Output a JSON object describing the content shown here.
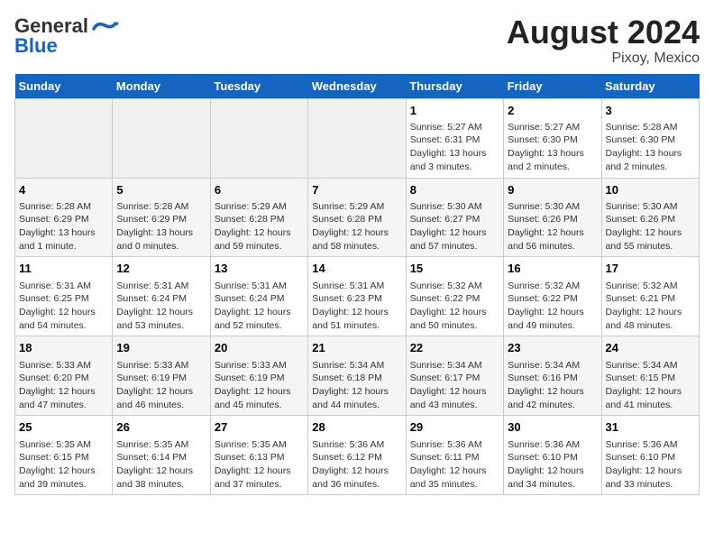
{
  "header": {
    "logo_general": "General",
    "logo_blue": "Blue",
    "title": "August 2024",
    "subtitle": "Pixoy, Mexico"
  },
  "days_of_week": [
    "Sunday",
    "Monday",
    "Tuesday",
    "Wednesday",
    "Thursday",
    "Friday",
    "Saturday"
  ],
  "weeks": [
    [
      {
        "day": "",
        "info": ""
      },
      {
        "day": "",
        "info": ""
      },
      {
        "day": "",
        "info": ""
      },
      {
        "day": "",
        "info": ""
      },
      {
        "day": "1",
        "info": "Sunrise: 5:27 AM\nSunset: 6:31 PM\nDaylight: 13 hours\nand 3 minutes."
      },
      {
        "day": "2",
        "info": "Sunrise: 5:27 AM\nSunset: 6:30 PM\nDaylight: 13 hours\nand 2 minutes."
      },
      {
        "day": "3",
        "info": "Sunrise: 5:28 AM\nSunset: 6:30 PM\nDaylight: 13 hours\nand 2 minutes."
      }
    ],
    [
      {
        "day": "4",
        "info": "Sunrise: 5:28 AM\nSunset: 6:29 PM\nDaylight: 13 hours\nand 1 minute."
      },
      {
        "day": "5",
        "info": "Sunrise: 5:28 AM\nSunset: 6:29 PM\nDaylight: 13 hours\nand 0 minutes."
      },
      {
        "day": "6",
        "info": "Sunrise: 5:29 AM\nSunset: 6:28 PM\nDaylight: 12 hours\nand 59 minutes."
      },
      {
        "day": "7",
        "info": "Sunrise: 5:29 AM\nSunset: 6:28 PM\nDaylight: 12 hours\nand 58 minutes."
      },
      {
        "day": "8",
        "info": "Sunrise: 5:30 AM\nSunset: 6:27 PM\nDaylight: 12 hours\nand 57 minutes."
      },
      {
        "day": "9",
        "info": "Sunrise: 5:30 AM\nSunset: 6:26 PM\nDaylight: 12 hours\nand 56 minutes."
      },
      {
        "day": "10",
        "info": "Sunrise: 5:30 AM\nSunset: 6:26 PM\nDaylight: 12 hours\nand 55 minutes."
      }
    ],
    [
      {
        "day": "11",
        "info": "Sunrise: 5:31 AM\nSunset: 6:25 PM\nDaylight: 12 hours\nand 54 minutes."
      },
      {
        "day": "12",
        "info": "Sunrise: 5:31 AM\nSunset: 6:24 PM\nDaylight: 12 hours\nand 53 minutes."
      },
      {
        "day": "13",
        "info": "Sunrise: 5:31 AM\nSunset: 6:24 PM\nDaylight: 12 hours\nand 52 minutes."
      },
      {
        "day": "14",
        "info": "Sunrise: 5:31 AM\nSunset: 6:23 PM\nDaylight: 12 hours\nand 51 minutes."
      },
      {
        "day": "15",
        "info": "Sunrise: 5:32 AM\nSunset: 6:22 PM\nDaylight: 12 hours\nand 50 minutes."
      },
      {
        "day": "16",
        "info": "Sunrise: 5:32 AM\nSunset: 6:22 PM\nDaylight: 12 hours\nand 49 minutes."
      },
      {
        "day": "17",
        "info": "Sunrise: 5:32 AM\nSunset: 6:21 PM\nDaylight: 12 hours\nand 48 minutes."
      }
    ],
    [
      {
        "day": "18",
        "info": "Sunrise: 5:33 AM\nSunset: 6:20 PM\nDaylight: 12 hours\nand 47 minutes."
      },
      {
        "day": "19",
        "info": "Sunrise: 5:33 AM\nSunset: 6:19 PM\nDaylight: 12 hours\nand 46 minutes."
      },
      {
        "day": "20",
        "info": "Sunrise: 5:33 AM\nSunset: 6:19 PM\nDaylight: 12 hours\nand 45 minutes."
      },
      {
        "day": "21",
        "info": "Sunrise: 5:34 AM\nSunset: 6:18 PM\nDaylight: 12 hours\nand 44 minutes."
      },
      {
        "day": "22",
        "info": "Sunrise: 5:34 AM\nSunset: 6:17 PM\nDaylight: 12 hours\nand 43 minutes."
      },
      {
        "day": "23",
        "info": "Sunrise: 5:34 AM\nSunset: 6:16 PM\nDaylight: 12 hours\nand 42 minutes."
      },
      {
        "day": "24",
        "info": "Sunrise: 5:34 AM\nSunset: 6:15 PM\nDaylight: 12 hours\nand 41 minutes."
      }
    ],
    [
      {
        "day": "25",
        "info": "Sunrise: 5:35 AM\nSunset: 6:15 PM\nDaylight: 12 hours\nand 39 minutes."
      },
      {
        "day": "26",
        "info": "Sunrise: 5:35 AM\nSunset: 6:14 PM\nDaylight: 12 hours\nand 38 minutes."
      },
      {
        "day": "27",
        "info": "Sunrise: 5:35 AM\nSunset: 6:13 PM\nDaylight: 12 hours\nand 37 minutes."
      },
      {
        "day": "28",
        "info": "Sunrise: 5:36 AM\nSunset: 6:12 PM\nDaylight: 12 hours\nand 36 minutes."
      },
      {
        "day": "29",
        "info": "Sunrise: 5:36 AM\nSunset: 6:11 PM\nDaylight: 12 hours\nand 35 minutes."
      },
      {
        "day": "30",
        "info": "Sunrise: 5:36 AM\nSunset: 6:10 PM\nDaylight: 12 hours\nand 34 minutes."
      },
      {
        "day": "31",
        "info": "Sunrise: 5:36 AM\nSunset: 6:10 PM\nDaylight: 12 hours\nand 33 minutes."
      }
    ]
  ]
}
